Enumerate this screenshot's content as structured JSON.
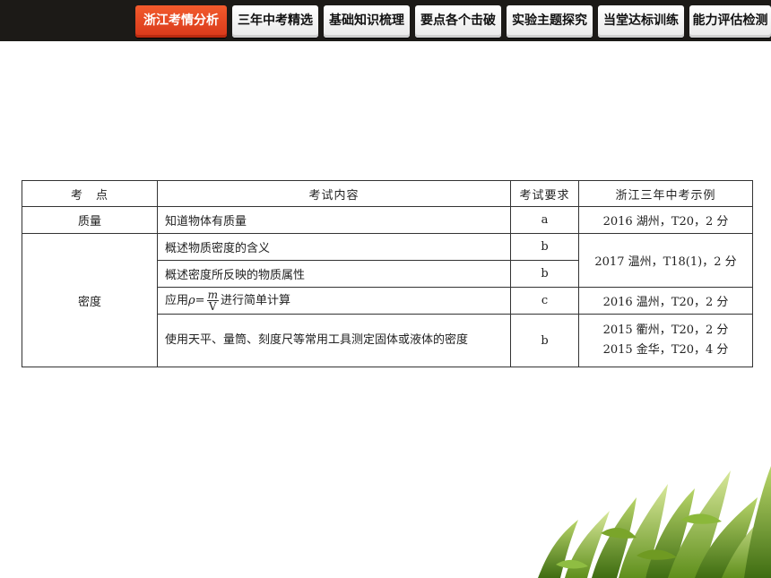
{
  "nav": {
    "tabs": [
      {
        "label": "浙江考情分析",
        "active": true
      },
      {
        "label": "三年中考精选",
        "active": false
      },
      {
        "label": "基础知识梳理",
        "active": false
      },
      {
        "label": "要点各个击破",
        "active": false
      },
      {
        "label": "实验主题探究",
        "active": false
      },
      {
        "label": "当堂达标训练",
        "active": false
      },
      {
        "label": "能力评估检测",
        "active": false
      }
    ]
  },
  "table": {
    "headers": [
      "考　点",
      "考试内容",
      "考试要求",
      "浙江三年中考示例"
    ],
    "rows": [
      {
        "topic": "质量",
        "content": "知道物体有质量",
        "req": "a",
        "example": "2016 湖州，T20，2 分"
      },
      {
        "topic": "密度",
        "content": "概述物质密度的含义",
        "req": "b",
        "example": "2017 温州，T18(1)，2 分"
      },
      {
        "content": "概述密度所反映的物质属性",
        "req": "b"
      },
      {
        "content_prefix": "应用",
        "formula": {
          "lhs": "ρ=",
          "num": "m",
          "den": "V"
        },
        "content_suffix": "进行简单计算",
        "req": "c",
        "example": "2016 温州，T20，2 分"
      },
      {
        "content": "使用天平、量筒、刻度尺等常用工具测定固体或液体的密度",
        "req": "b",
        "examples": [
          "2015 衢州，T20，2 分",
          "2015 金华，T20，4 分"
        ]
      }
    ]
  }
}
